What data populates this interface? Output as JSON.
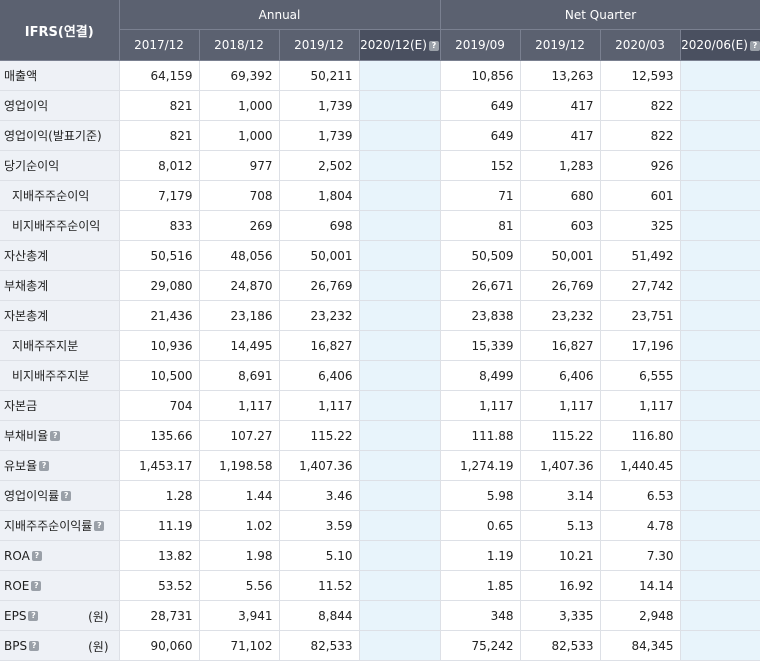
{
  "header": {
    "corner": "IFRS(연결)",
    "annual": "Annual",
    "quarter": "Net Quarter",
    "annual_periods": [
      "2017/12",
      "2018/12",
      "2019/12",
      "2020/12(E)"
    ],
    "quarter_periods": [
      "2019/09",
      "2019/12",
      "2020/03",
      "2020/06(E)"
    ]
  },
  "rows": [
    {
      "label": "매출액",
      "sub": false,
      "help": false,
      "unit": "",
      "annual": [
        "64,159",
        "69,392",
        "50,211",
        ""
      ],
      "quarter": [
        "10,856",
        "13,263",
        "12,593",
        ""
      ]
    },
    {
      "label": "영업이익",
      "sub": false,
      "help": false,
      "unit": "",
      "annual": [
        "821",
        "1,000",
        "1,739",
        ""
      ],
      "quarter": [
        "649",
        "417",
        "822",
        ""
      ]
    },
    {
      "label": "영업이익(발표기준)",
      "sub": false,
      "help": false,
      "unit": "",
      "annual": [
        "821",
        "1,000",
        "1,739",
        ""
      ],
      "quarter": [
        "649",
        "417",
        "822",
        ""
      ]
    },
    {
      "label": "당기순이익",
      "sub": false,
      "help": false,
      "unit": "",
      "annual": [
        "8,012",
        "977",
        "2,502",
        ""
      ],
      "quarter": [
        "152",
        "1,283",
        "926",
        ""
      ]
    },
    {
      "label": "지배주주순이익",
      "sub": true,
      "help": false,
      "unit": "",
      "annual": [
        "7,179",
        "708",
        "1,804",
        ""
      ],
      "quarter": [
        "71",
        "680",
        "601",
        ""
      ]
    },
    {
      "label": "비지배주주순이익",
      "sub": true,
      "help": false,
      "unit": "",
      "annual": [
        "833",
        "269",
        "698",
        ""
      ],
      "quarter": [
        "81",
        "603",
        "325",
        ""
      ]
    },
    {
      "label": "자산총계",
      "sub": false,
      "help": false,
      "unit": "",
      "annual": [
        "50,516",
        "48,056",
        "50,001",
        ""
      ],
      "quarter": [
        "50,509",
        "50,001",
        "51,492",
        ""
      ]
    },
    {
      "label": "부채총계",
      "sub": false,
      "help": false,
      "unit": "",
      "annual": [
        "29,080",
        "24,870",
        "26,769",
        ""
      ],
      "quarter": [
        "26,671",
        "26,769",
        "27,742",
        ""
      ]
    },
    {
      "label": "자본총계",
      "sub": false,
      "help": false,
      "unit": "",
      "annual": [
        "21,436",
        "23,186",
        "23,232",
        ""
      ],
      "quarter": [
        "23,838",
        "23,232",
        "23,751",
        ""
      ]
    },
    {
      "label": "지배주주지분",
      "sub": true,
      "help": false,
      "unit": "",
      "annual": [
        "10,936",
        "14,495",
        "16,827",
        ""
      ],
      "quarter": [
        "15,339",
        "16,827",
        "17,196",
        ""
      ]
    },
    {
      "label": "비지배주주지분",
      "sub": true,
      "help": false,
      "unit": "",
      "annual": [
        "10,500",
        "8,691",
        "6,406",
        ""
      ],
      "quarter": [
        "8,499",
        "6,406",
        "6,555",
        ""
      ]
    },
    {
      "label": "자본금",
      "sub": false,
      "help": false,
      "unit": "",
      "annual": [
        "704",
        "1,117",
        "1,117",
        ""
      ],
      "quarter": [
        "1,117",
        "1,117",
        "1,117",
        ""
      ]
    },
    {
      "label": "부채비율",
      "sub": false,
      "help": true,
      "unit": "",
      "annual": [
        "135.66",
        "107.27",
        "115.22",
        ""
      ],
      "quarter": [
        "111.88",
        "115.22",
        "116.80",
        ""
      ]
    },
    {
      "label": "유보율",
      "sub": false,
      "help": true,
      "unit": "",
      "annual": [
        "1,453.17",
        "1,198.58",
        "1,407.36",
        ""
      ],
      "quarter": [
        "1,274.19",
        "1,407.36",
        "1,440.45",
        ""
      ]
    },
    {
      "label": "영업이익률",
      "sub": false,
      "help": true,
      "unit": "",
      "annual": [
        "1.28",
        "1.44",
        "3.46",
        ""
      ],
      "quarter": [
        "5.98",
        "3.14",
        "6.53",
        ""
      ]
    },
    {
      "label": "지배주주순이익률",
      "sub": false,
      "help": true,
      "unit": "",
      "annual": [
        "11.19",
        "1.02",
        "3.59",
        ""
      ],
      "quarter": [
        "0.65",
        "5.13",
        "4.78",
        ""
      ]
    },
    {
      "label": "ROA",
      "sub": false,
      "help": true,
      "unit": "",
      "annual": [
        "13.82",
        "1.98",
        "5.10",
        ""
      ],
      "quarter": [
        "1.19",
        "10.21",
        "7.30",
        ""
      ]
    },
    {
      "label": "ROE",
      "sub": false,
      "help": true,
      "unit": "",
      "annual": [
        "53.52",
        "5.56",
        "11.52",
        ""
      ],
      "quarter": [
        "1.85",
        "16.92",
        "14.14",
        ""
      ]
    },
    {
      "label": "EPS",
      "sub": false,
      "help": true,
      "unit": "(원)",
      "annual": [
        "28,731",
        "3,941",
        "8,844",
        ""
      ],
      "quarter": [
        "348",
        "3,335",
        "2,948",
        ""
      ]
    },
    {
      "label": "BPS",
      "sub": false,
      "help": true,
      "unit": "(원)",
      "annual": [
        "90,060",
        "71,102",
        "82,533",
        ""
      ],
      "quarter": [
        "75,242",
        "82,533",
        "84,345",
        ""
      ]
    }
  ]
}
